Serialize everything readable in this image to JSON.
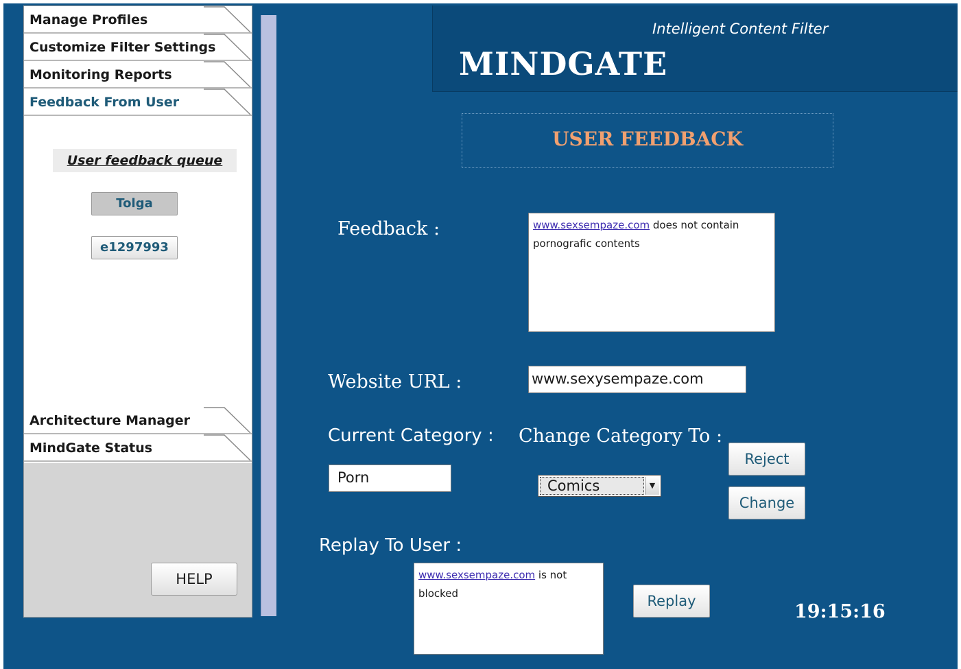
{
  "sidebar": {
    "tabs_top": [
      {
        "label": "Manage Profiles"
      },
      {
        "label": "Customize Filter Settings"
      },
      {
        "label": "Monitoring Reports"
      },
      {
        "label": "Feedback From User"
      }
    ],
    "tabs_bottom": [
      {
        "label": "Architecture Manager"
      },
      {
        "label": "MindGate Status"
      }
    ],
    "queue_title": "User feedback queue",
    "queue_items": [
      {
        "label": "Tolga"
      },
      {
        "label": "e1297993"
      }
    ],
    "help_label": "HELP"
  },
  "header": {
    "tagline": "Intelligent Content Filter",
    "brand": "MINDGATE"
  },
  "main": {
    "page_title": "USER FEEDBACK",
    "feedback_label": "Feedback :",
    "feedback_link": "www.sexsempaze.com",
    "feedback_text": " does not contain pornografic contents",
    "url_label": "Website URL :",
    "url_value": "www.sexysempaze.com",
    "current_category_label": "Current Category :",
    "current_category_value": "Porn",
    "change_category_label": "Change Category To :",
    "change_category_selected": "Comics",
    "reject_label": "Reject",
    "change_label": "Change",
    "reply_label": "Replay To User :",
    "reply_link": "www.sexsempaze.com",
    "reply_text": " is not blocked",
    "replay_button": "Replay",
    "clock": "19:15:16"
  },
  "colors": {
    "background": "#0e5488",
    "header": "#0b4a7a",
    "title_accent": "#f0a070",
    "active_tab_text": "#1f5b78"
  }
}
